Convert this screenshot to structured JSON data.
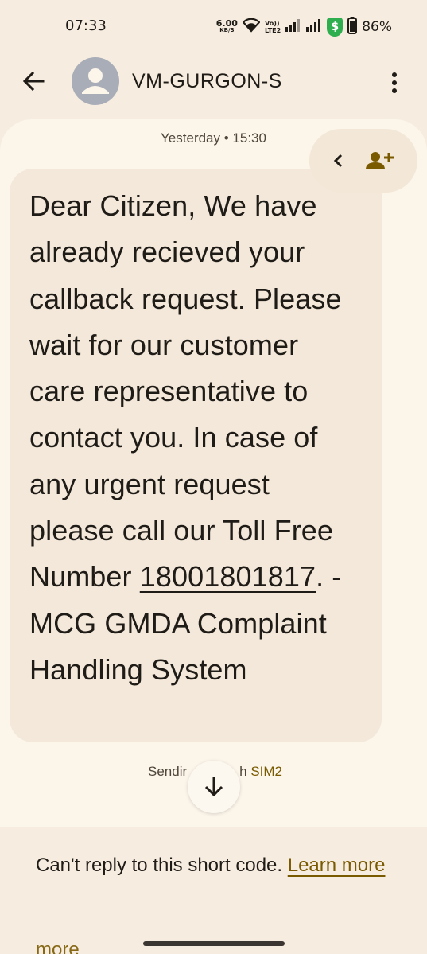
{
  "status_bar": {
    "time": "07:33",
    "net_speed_value": "6.00",
    "net_speed_unit": "KB/S",
    "volte_top": "Vo))",
    "volte_bottom": "LTE2",
    "shield_symbol": "$",
    "battery": "86%"
  },
  "app_bar": {
    "contact_name": "VM-GURGON-S"
  },
  "conversation": {
    "timestamp": "Yesterday • 15:30",
    "message_before_number": "Dear Citizen, We have already recieved your callback request. Please wait for our customer care representative to contact you. In case of any urgent request please call our Toll Free Number ",
    "phone_number": "18001801817",
    "message_after_number": ". -MCG GMDA Complaint Handling System",
    "sending_prefix": "Sendir",
    "sending_suffix": "h ",
    "sim_label": "SIM2"
  },
  "footer": {
    "notice": "Can't reply to this short code. ",
    "learn_more": "Learn more",
    "ghost_text": "more"
  },
  "colors": {
    "background": "#f6ece0",
    "conversation_bg": "#fbf5ea",
    "bubble_bg": "#f3e8da",
    "accent_link": "#7a5a00",
    "shield_green": "#2fae4f",
    "avatar_grey": "#a8adb8"
  },
  "icons": [
    "wifi-icon",
    "signal-icon",
    "shield-icon",
    "battery-icon",
    "back-arrow-icon",
    "person-icon",
    "more-vert-icon",
    "chevron-left-icon",
    "add-contact-icon",
    "arrow-down-icon"
  ]
}
